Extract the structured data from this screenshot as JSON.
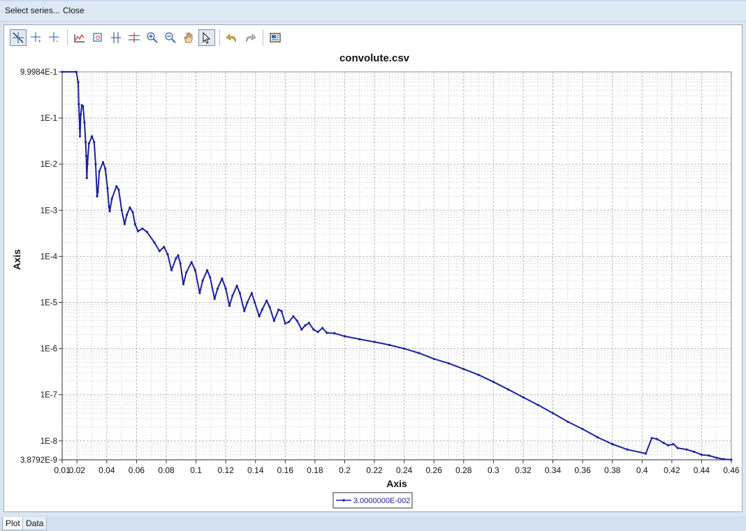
{
  "menu": {
    "select_series": "Select series...",
    "close": "Close"
  },
  "toolbar": {
    "buttons": [
      {
        "name": "select-zoom-tool-button",
        "icon": "crosshair-zoom-icon"
      },
      {
        "name": "add-point-button",
        "icon": "crosshair-plus-icon"
      },
      {
        "name": "remove-point-button",
        "icon": "crosshair-minus-icon"
      },
      {
        "name": "chart-options-button",
        "icon": "chart-icon"
      },
      {
        "name": "zoom-box-button",
        "icon": "zoom-box-icon"
      },
      {
        "name": "vertical-cursor-button",
        "icon": "vertical-split-icon"
      },
      {
        "name": "horizontal-cursor-button",
        "icon": "horizontal-split-icon"
      },
      {
        "name": "zoom-in-button",
        "icon": "zoom-in-icon"
      },
      {
        "name": "zoom-out-button",
        "icon": "zoom-out-icon"
      },
      {
        "name": "pan-button",
        "icon": "hand-icon"
      },
      {
        "name": "pointer-button",
        "icon": "cursor-icon"
      },
      {
        "name": "undo-button",
        "icon": "undo-icon"
      },
      {
        "name": "redo-button",
        "icon": "redo-icon"
      },
      {
        "name": "copy-image-button",
        "icon": "copy-image-icon"
      }
    ]
  },
  "tabs": {
    "plot": "Plot",
    "data": "Data"
  },
  "chart_data": {
    "type": "line",
    "title": "convolute.csv",
    "xlabel": "Axis",
    "ylabel": "Axis",
    "xlim": [
      0.01,
      0.46
    ],
    "ylim": [
      3.8792e-09,
      0.99984
    ],
    "yscale": "log",
    "grid": true,
    "legend_position": "bottom-center",
    "series_color": "#1c20a0",
    "x_ticks": [
      "0.01",
      "0.02",
      "0.04",
      "0.06",
      "0.08",
      "0.1",
      "0.12",
      "0.14",
      "0.16",
      "0.18",
      "0.2",
      "0.22",
      "0.24",
      "0.26",
      "0.28",
      "0.3",
      "0.32",
      "0.34",
      "0.36",
      "0.38",
      "0.4",
      "0.42",
      "0.44",
      "0.46"
    ],
    "y_ticks": [
      "9.9984E-1",
      "1E-1",
      "1E-2",
      "1E-3",
      "1E-4",
      "1E-5",
      "1E-6",
      "1E-7",
      "1E-8",
      "3.8792E-9"
    ],
    "series": [
      {
        "name": "3.0000000E-002",
        "points": [
          [
            0.01,
            0.99984
          ],
          [
            0.0195,
            0.99984
          ],
          [
            0.0208,
            0.6
          ],
          [
            0.0212,
            0.2
          ],
          [
            0.0218,
            0.06
          ],
          [
            0.022,
            0.04
          ],
          [
            0.0225,
            0.12
          ],
          [
            0.0232,
            0.19
          ],
          [
            0.024,
            0.18
          ],
          [
            0.025,
            0.08
          ],
          [
            0.0258,
            0.03
          ],
          [
            0.0262,
            0.015
          ],
          [
            0.0266,
            0.005
          ],
          [
            0.027,
            0.01
          ],
          [
            0.028,
            0.028
          ],
          [
            0.03,
            0.04
          ],
          [
            0.0315,
            0.03
          ],
          [
            0.0325,
            0.01
          ],
          [
            0.0335,
            0.002
          ],
          [
            0.034,
            0.0025
          ],
          [
            0.035,
            0.007
          ],
          [
            0.0375,
            0.011
          ],
          [
            0.039,
            0.008
          ],
          [
            0.0405,
            0.003
          ],
          [
            0.0415,
            0.0012
          ],
          [
            0.042,
            0.00095
          ],
          [
            0.0435,
            0.0018
          ],
          [
            0.0465,
            0.0033
          ],
          [
            0.048,
            0.0028
          ],
          [
            0.05,
            0.001
          ],
          [
            0.052,
            0.0005
          ],
          [
            0.0535,
            0.0008
          ],
          [
            0.0555,
            0.00115
          ],
          [
            0.0575,
            0.0009
          ],
          [
            0.059,
            0.0005
          ],
          [
            0.061,
            0.00035
          ],
          [
            0.064,
            0.0004
          ],
          [
            0.067,
            0.00034
          ],
          [
            0.072,
            0.0002
          ],
          [
            0.0755,
            0.00013
          ],
          [
            0.0785,
            0.00016
          ],
          [
            0.081,
            0.00011
          ],
          [
            0.0835,
            5e-05
          ],
          [
            0.0865,
            9e-05
          ],
          [
            0.088,
            0.000105
          ],
          [
            0.0895,
            7e-05
          ],
          [
            0.0915,
            2.5e-05
          ],
          [
            0.0935,
            4.5e-05
          ],
          [
            0.097,
            7.5e-05
          ],
          [
            0.0995,
            5e-05
          ],
          [
            0.1025,
            1.6e-05
          ],
          [
            0.1045,
            3e-05
          ],
          [
            0.1075,
            5e-05
          ],
          [
            0.1095,
            3.5e-05
          ],
          [
            0.1125,
            1.2e-05
          ],
          [
            0.1145,
            2e-05
          ],
          [
            0.1175,
            3.3e-05
          ],
          [
            0.12,
            2e-05
          ],
          [
            0.1225,
            8.5e-06
          ],
          [
            0.1245,
            1.4e-05
          ],
          [
            0.1275,
            2.3e-05
          ],
          [
            0.1295,
            1.6e-05
          ],
          [
            0.1325,
            6.5e-06
          ],
          [
            0.1345,
            1e-05
          ],
          [
            0.1375,
            1.6e-05
          ],
          [
            0.1395,
            1e-05
          ],
          [
            0.1425,
            5e-06
          ],
          [
            0.1445,
            7e-06
          ],
          [
            0.1475,
            1.1e-05
          ],
          [
            0.1495,
            8e-06
          ],
          [
            0.1525,
            4e-06
          ],
          [
            0.1555,
            7e-06
          ],
          [
            0.1575,
            6.5e-06
          ],
          [
            0.16,
            3.5e-06
          ],
          [
            0.1625,
            3.8e-06
          ],
          [
            0.1655,
            5e-06
          ],
          [
            0.168,
            4e-06
          ],
          [
            0.171,
            2.6e-06
          ],
          [
            0.1735,
            3.2e-06
          ],
          [
            0.176,
            3.6e-06
          ],
          [
            0.179,
            2.6e-06
          ],
          [
            0.182,
            2.3e-06
          ],
          [
            0.185,
            2.8e-06
          ],
          [
            0.188,
            2.2e-06
          ],
          [
            0.193,
            2.15e-06
          ],
          [
            0.2,
            1.85e-06
          ],
          [
            0.21,
            1.6e-06
          ],
          [
            0.22,
            1.4e-06
          ],
          [
            0.23,
            1.2e-06
          ],
          [
            0.24,
            1e-06
          ],
          [
            0.25,
            8e-07
          ],
          [
            0.26,
            6e-07
          ],
          [
            0.27,
            4.8e-07
          ],
          [
            0.28,
            3.6e-07
          ],
          [
            0.29,
            2.7e-07
          ],
          [
            0.3,
            1.9e-07
          ],
          [
            0.31,
            1.3e-07
          ],
          [
            0.32,
            8.8e-08
          ],
          [
            0.33,
            6e-08
          ],
          [
            0.34,
            4e-08
          ],
          [
            0.35,
            2.6e-08
          ],
          [
            0.36,
            1.8e-08
          ],
          [
            0.37,
            1.2e-08
          ],
          [
            0.38,
            8.5e-09
          ],
          [
            0.39,
            6.5e-09
          ],
          [
            0.4025,
            5.3e-09
          ],
          [
            0.4065,
            1.15e-08
          ],
          [
            0.41,
            1.1e-08
          ],
          [
            0.4145,
            9e-09
          ],
          [
            0.4175,
            8e-09
          ],
          [
            0.421,
            8.5e-09
          ],
          [
            0.424,
            7e-09
          ],
          [
            0.43,
            6.5e-09
          ],
          [
            0.435,
            5.8e-09
          ],
          [
            0.44,
            5e-09
          ],
          [
            0.445,
            4.8e-09
          ],
          [
            0.45,
            4.3e-09
          ],
          [
            0.455,
            4e-09
          ],
          [
            0.46,
            3.9e-09
          ]
        ]
      }
    ]
  }
}
